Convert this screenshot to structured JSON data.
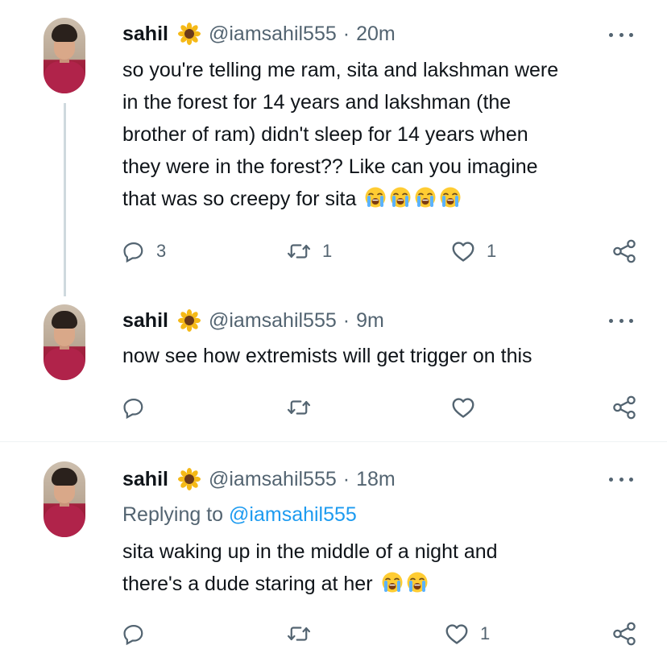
{
  "tweets": [
    {
      "name": "sahil",
      "handle": "@iamsahil555",
      "separator": "·",
      "time": "20m",
      "lines": [
        "so you're telling me ram, sita and lakshman were",
        "in the forest for 14 years and lakshman (the",
        "brother of ram) didn't sleep for 14 years when",
        "they were in the forest?? Like can you imagine",
        "that was so creepy for sita"
      ],
      "emoji_count": 4,
      "emoji": "loudly-crying-face",
      "reply_count": "3",
      "retweet_count": "1",
      "like_count": "1"
    },
    {
      "name": "sahil",
      "handle": "@iamsahil555",
      "separator": "·",
      "time": "9m",
      "lines": [
        "now see how extremists will get trigger on this"
      ],
      "reply_count": "",
      "retweet_count": "",
      "like_count": ""
    },
    {
      "name": "sahil",
      "handle": "@iamsahil555",
      "separator": "·",
      "time": "18m",
      "replying_prefix": "Replying to",
      "replying_handle": "@iamsahil555",
      "lines": [
        "sita waking up in the middle of a night and",
        "there's a dude staring at her"
      ],
      "emoji_count": 2,
      "emoji": "loudly-crying-face",
      "reply_count": "",
      "retweet_count": "",
      "like_count": "1"
    }
  ],
  "icons": {
    "name_badge": "sunflower-icon",
    "reply": "reply-icon",
    "retweet": "retweet-icon",
    "like": "heart-icon",
    "share": "share-icon",
    "more": "more-icon"
  },
  "colors": {
    "text": "#0f1419",
    "secondary": "#536471",
    "link": "#1d9bf0",
    "thread_line": "#cfd9de",
    "divider": "#eff3f4"
  }
}
